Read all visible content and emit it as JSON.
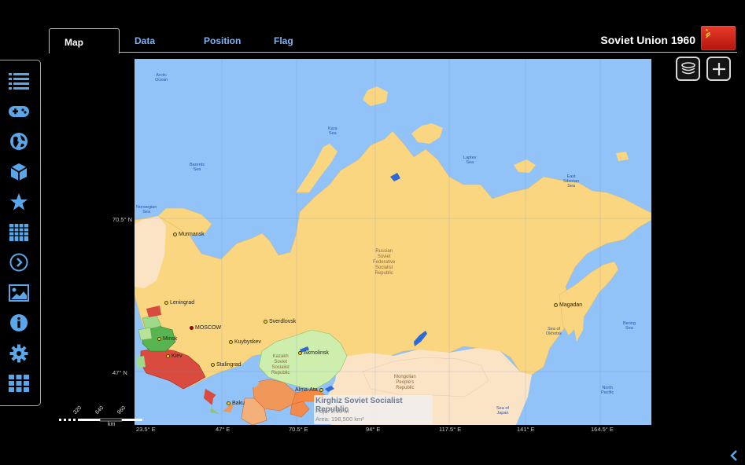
{
  "tabs": [
    {
      "label": "Map",
      "active": true
    },
    {
      "label": "Data",
      "active": false
    },
    {
      "label": "Position",
      "active": false
    },
    {
      "label": "Flag",
      "active": false
    }
  ],
  "header": {
    "title": "Soviet Union 1960"
  },
  "sidebar": {
    "icons": [
      "list-icon",
      "gamepad-icon",
      "globe-icon",
      "cube-icon",
      "star-icon",
      "grid-table-icon",
      "chevron-right-circle-icon",
      "image-icon",
      "info-icon",
      "gear-icon",
      "apps-grid-icon"
    ]
  },
  "map": {
    "seas": {
      "arctic": "Arctic\nOcean",
      "kara": "Kara\nSea",
      "barents": "Barents\nSea",
      "laptev": "Laptev\nSea",
      "east_siberian": "East\nSiberian\nSea",
      "norwegian": "Norwegian\nSea",
      "okhotsk": "Sea of\nOkhotsk",
      "bering": "Bering\nSea",
      "japan": "Sea of\nJapan",
      "north_pacific": "North\nPacific"
    },
    "regions": {
      "rsfsr": "Russian\nSoviet\nFederative\nSocialist\nRepublic",
      "kazakh": "Kazakh\nSoviet\nSocialist\nRepublic",
      "mongolia": "Mongolian\nPeople's\nRepublic"
    },
    "cities": {
      "murmansk": "Murmansk",
      "leningrad": "Leningrad",
      "moscow": "MOSCOW",
      "sverdlovsk": "Sverdlovsk",
      "minsk": "Minsk",
      "kuybyshev": "Kuybyskev",
      "kiev": "Kiev",
      "stalingrad": "Stalingrad",
      "akmolinsk": "Akmolinsk",
      "magadan": "Magadan",
      "alma_ata": "Alma-Ata",
      "baku": "Baku"
    },
    "tooltip": {
      "title": "Kirghiz Soviet Socialist Republic",
      "population": "Pop.: 2.10 M",
      "area": "Area: 198,500 km²"
    },
    "longitudes": [
      "23.5° E",
      "47° E",
      "70.5° E",
      "94° E",
      "117.5° E",
      "141° E",
      "164.5° E"
    ],
    "latitudes": [
      "70.5° N",
      "47° N"
    ],
    "scale": {
      "marks": [
        "320",
        "640",
        "960"
      ],
      "unit": "km"
    },
    "colors": {
      "water": "#91c2f8",
      "rsfsr": "#fbd681",
      "kazakh": "#cdeeac",
      "ukraine": "#d84b3e",
      "belarus": "#58b450",
      "baltic": "#9fd98a",
      "central_asia": "#f0985a",
      "foreign": "#fbe4c6"
    }
  },
  "controls": {
    "layers": "layers-icon",
    "zoom": "plus-square-icon",
    "back": "chevron-left-icon"
  }
}
